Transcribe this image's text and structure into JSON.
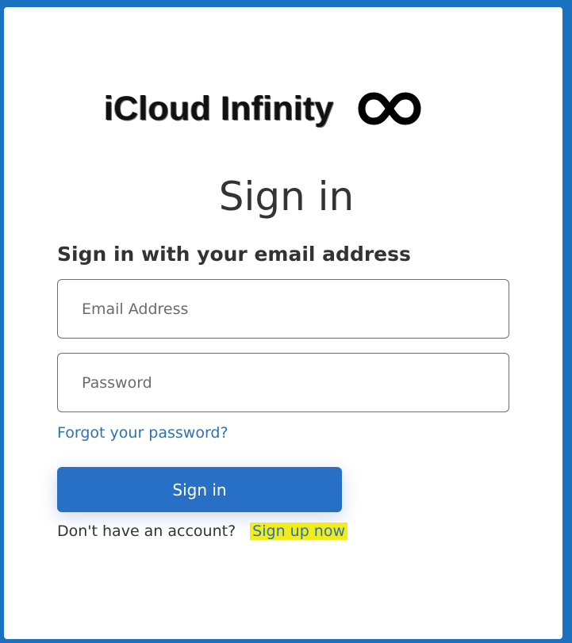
{
  "logo": {
    "text": "iCloud Infinity",
    "symbol": "∞",
    "symbol_icon": "infinity-icon"
  },
  "form": {
    "title": "Sign in",
    "subtitle": "Sign in with your email address",
    "email_placeholder": "Email Address",
    "email_value": "",
    "password_placeholder": "Password",
    "password_value": "",
    "forgot_link": "Forgot your password?",
    "submit_label": "Sign in",
    "signup_prompt": "Don't have an account?",
    "signup_link": "Sign up now"
  },
  "colors": {
    "page_background": "#1a72c0",
    "card_background": "#ffffff",
    "primary_button": "#2770c6",
    "link": "#2b73b6",
    "signup_highlight": "#f2ec1d",
    "heading_text": "#333333"
  }
}
